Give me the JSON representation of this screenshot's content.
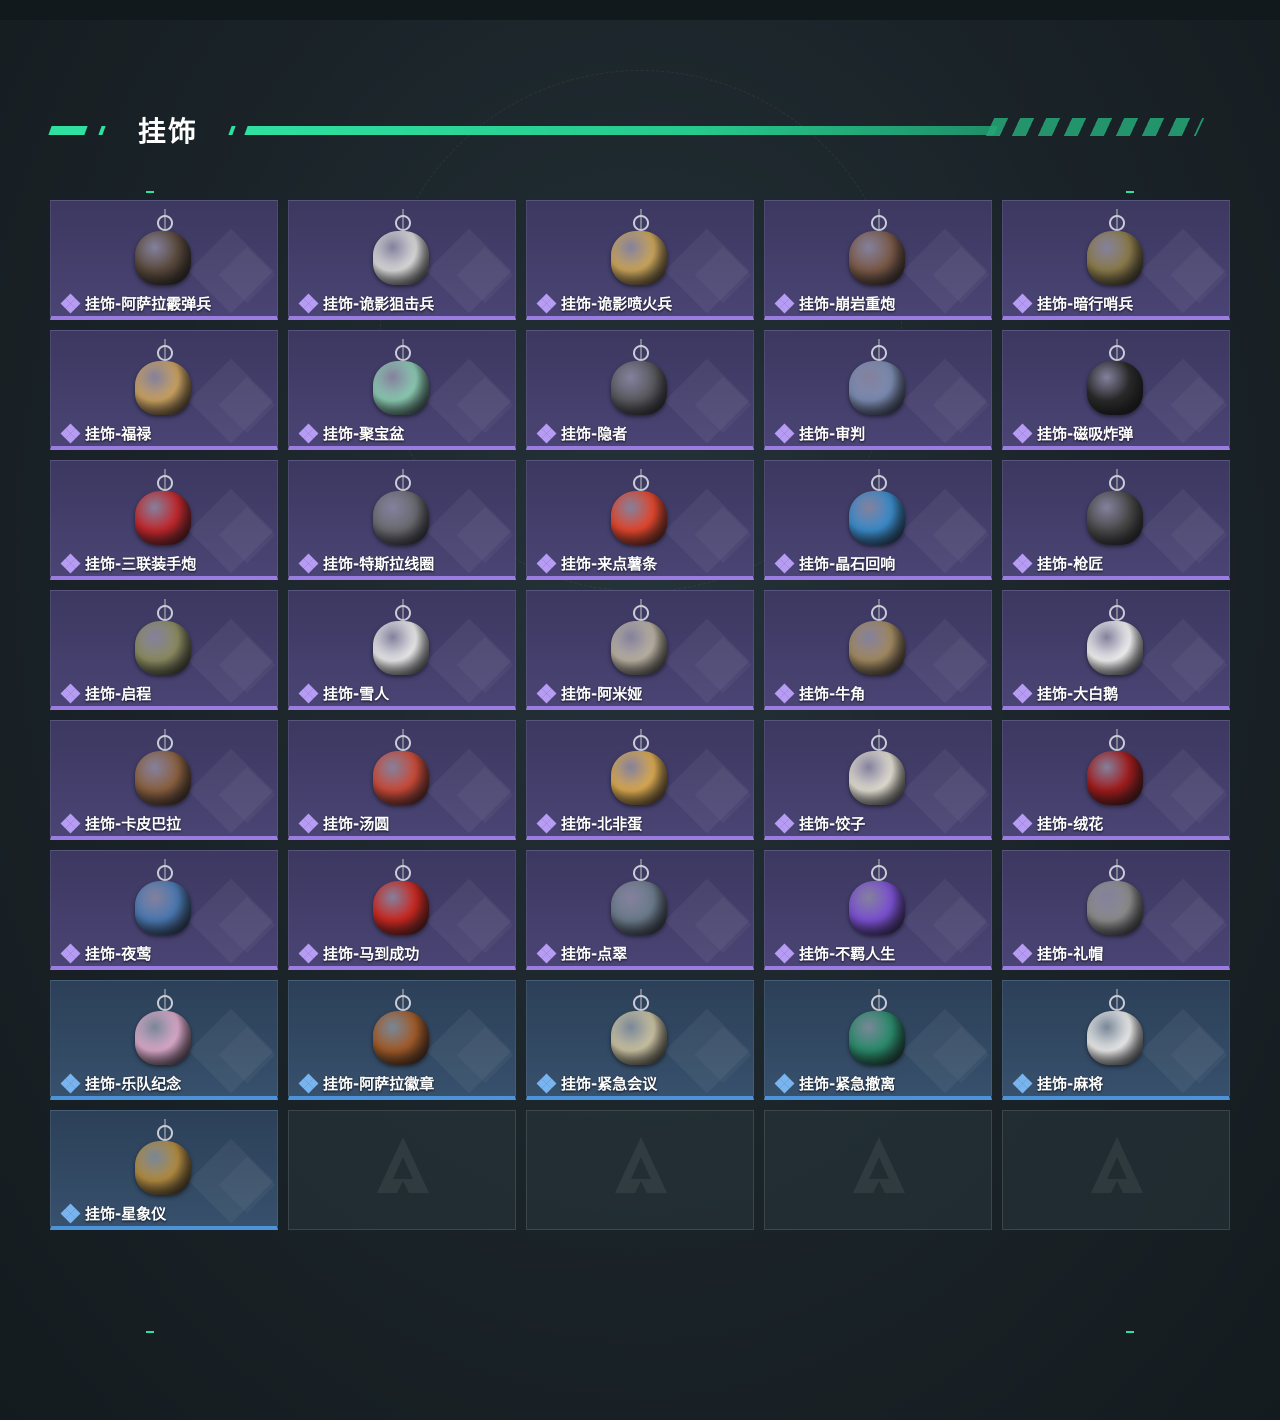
{
  "section": {
    "title": "挂饰"
  },
  "items": [
    {
      "label": "挂饰-阿萨拉霰弹兵",
      "rarity": "purple",
      "color": "#5a4a3c"
    },
    {
      "label": "挂饰-诡影狙击兵",
      "rarity": "purple",
      "color": "#d8d8d8"
    },
    {
      "label": "挂饰-诡影喷火兵",
      "rarity": "purple",
      "color": "#c9a45a"
    },
    {
      "label": "挂饰-崩岩重炮",
      "rarity": "purple",
      "color": "#7a5a48"
    },
    {
      "label": "挂饰-暗行哨兵",
      "rarity": "purple",
      "color": "#8a7a4a"
    },
    {
      "label": "挂饰-福禄",
      "rarity": "purple",
      "color": "#c8a060"
    },
    {
      "label": "挂饰-聚宝盆",
      "rarity": "purple",
      "color": "#8ac8b0"
    },
    {
      "label": "挂饰-隐者",
      "rarity": "purple",
      "color": "#5a5a60"
    },
    {
      "label": "挂饰-审判",
      "rarity": "purple",
      "color": "#7a8ab0"
    },
    {
      "label": "挂饰-磁吸炸弹",
      "rarity": "purple",
      "color": "#2a2a2a"
    },
    {
      "label": "挂饰-三联装手炮",
      "rarity": "purple",
      "color": "#c0282c"
    },
    {
      "label": "挂饰-特斯拉线圈",
      "rarity": "purple",
      "color": "#6a6a70"
    },
    {
      "label": "挂饰-来点薯条",
      "rarity": "purple",
      "color": "#e0462c"
    },
    {
      "label": "挂饰-晶石回响",
      "rarity": "purple",
      "color": "#3a8ac8"
    },
    {
      "label": "挂饰-枪匠",
      "rarity": "purple",
      "color": "#4a4a4a"
    },
    {
      "label": "挂饰-启程",
      "rarity": "purple",
      "color": "#8a8a60"
    },
    {
      "label": "挂饰-雪人",
      "rarity": "purple",
      "color": "#e8e8e8"
    },
    {
      "label": "挂饰-阿米娅",
      "rarity": "purple",
      "color": "#b8b0a0"
    },
    {
      "label": "挂饰-牛角",
      "rarity": "purple",
      "color": "#a08860"
    },
    {
      "label": "挂饰-大白鹅",
      "rarity": "purple",
      "color": "#f0f0f0"
    },
    {
      "label": "挂饰-卡皮巴拉",
      "rarity": "purple",
      "color": "#8a6040"
    },
    {
      "label": "挂饰-汤圆",
      "rarity": "purple",
      "color": "#c84a38"
    },
    {
      "label": "挂饰-北非蛋",
      "rarity": "purple",
      "color": "#d8a850"
    },
    {
      "label": "挂饰-饺子",
      "rarity": "purple",
      "color": "#e0dcd0"
    },
    {
      "label": "挂饰-绒花",
      "rarity": "purple",
      "color": "#a01c1c"
    },
    {
      "label": "挂饰-夜莺",
      "rarity": "purple",
      "color": "#4a78b0"
    },
    {
      "label": "挂饰-马到成功",
      "rarity": "purple",
      "color": "#c82820"
    },
    {
      "label": "挂饰-点翠",
      "rarity": "purple",
      "color": "#6a7a8a"
    },
    {
      "label": "挂饰-不羁人生",
      "rarity": "purple",
      "color": "#7a50d0"
    },
    {
      "label": "挂饰-礼帽",
      "rarity": "purple",
      "color": "#8a8a8a"
    },
    {
      "label": "挂饰-乐队纪念",
      "rarity": "blue",
      "color": "#d8a8c8"
    },
    {
      "label": "挂饰-阿萨拉徽章",
      "rarity": "blue",
      "color": "#a05a28"
    },
    {
      "label": "挂饰-紧急会议",
      "rarity": "blue",
      "color": "#c8c0a0"
    },
    {
      "label": "挂饰-紧急撤离",
      "rarity": "blue",
      "color": "#2a8a6a"
    },
    {
      "label": "挂饰-麻将",
      "rarity": "blue",
      "color": "#e8e8e8"
    },
    {
      "label": "挂饰-星象仪",
      "rarity": "blue",
      "color": "#b08a40"
    }
  ],
  "empty_slots": 4
}
